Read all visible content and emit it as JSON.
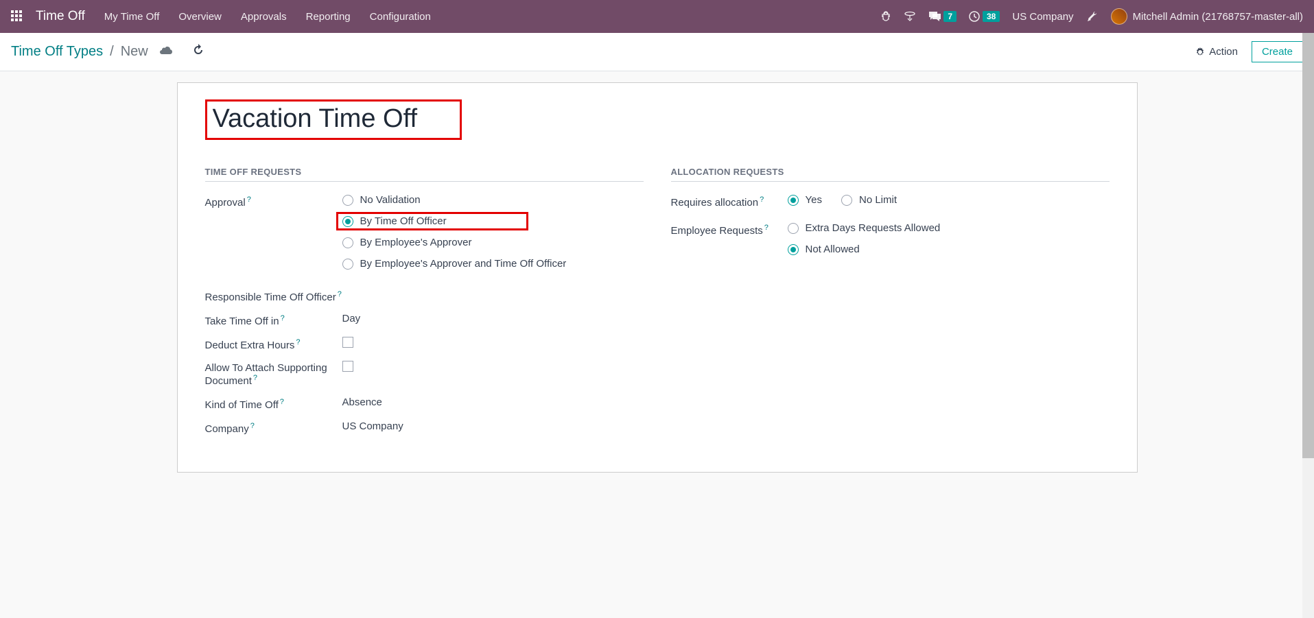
{
  "nav": {
    "brand": "Time Off",
    "items": [
      "My Time Off",
      "Overview",
      "Approvals",
      "Reporting",
      "Configuration"
    ],
    "msg_count": "7",
    "activity_count": "38",
    "company": "US Company",
    "user": "Mitchell Admin (21768757-master-all)"
  },
  "breadcrumb": {
    "parent": "Time Off Types",
    "current": "New"
  },
  "actions": {
    "action_label": "Action",
    "create_label": "Create"
  },
  "form": {
    "title": "Vacation Time Off",
    "left": {
      "section": "TIME OFF REQUESTS",
      "approval_label": "Approval",
      "approval_options": [
        "No Validation",
        "By Time Off Officer",
        "By Employee's Approver",
        "By Employee's Approver and Time Off Officer"
      ],
      "responsible_label": "Responsible Time Off Officer",
      "take_in_label": "Take Time Off in",
      "take_in_value": "Day",
      "deduct_label": "Deduct Extra Hours",
      "attach_label": "Allow To Attach Supporting Document",
      "kind_label": "Kind of Time Off",
      "kind_value": "Absence",
      "company_label": "Company",
      "company_value": "US Company"
    },
    "right": {
      "section": "ALLOCATION REQUESTS",
      "requires_label": "Requires allocation",
      "requires_options": [
        "Yes",
        "No Limit"
      ],
      "emp_req_label": "Employee Requests",
      "emp_req_options": [
        "Extra Days Requests Allowed",
        "Not Allowed"
      ]
    }
  }
}
